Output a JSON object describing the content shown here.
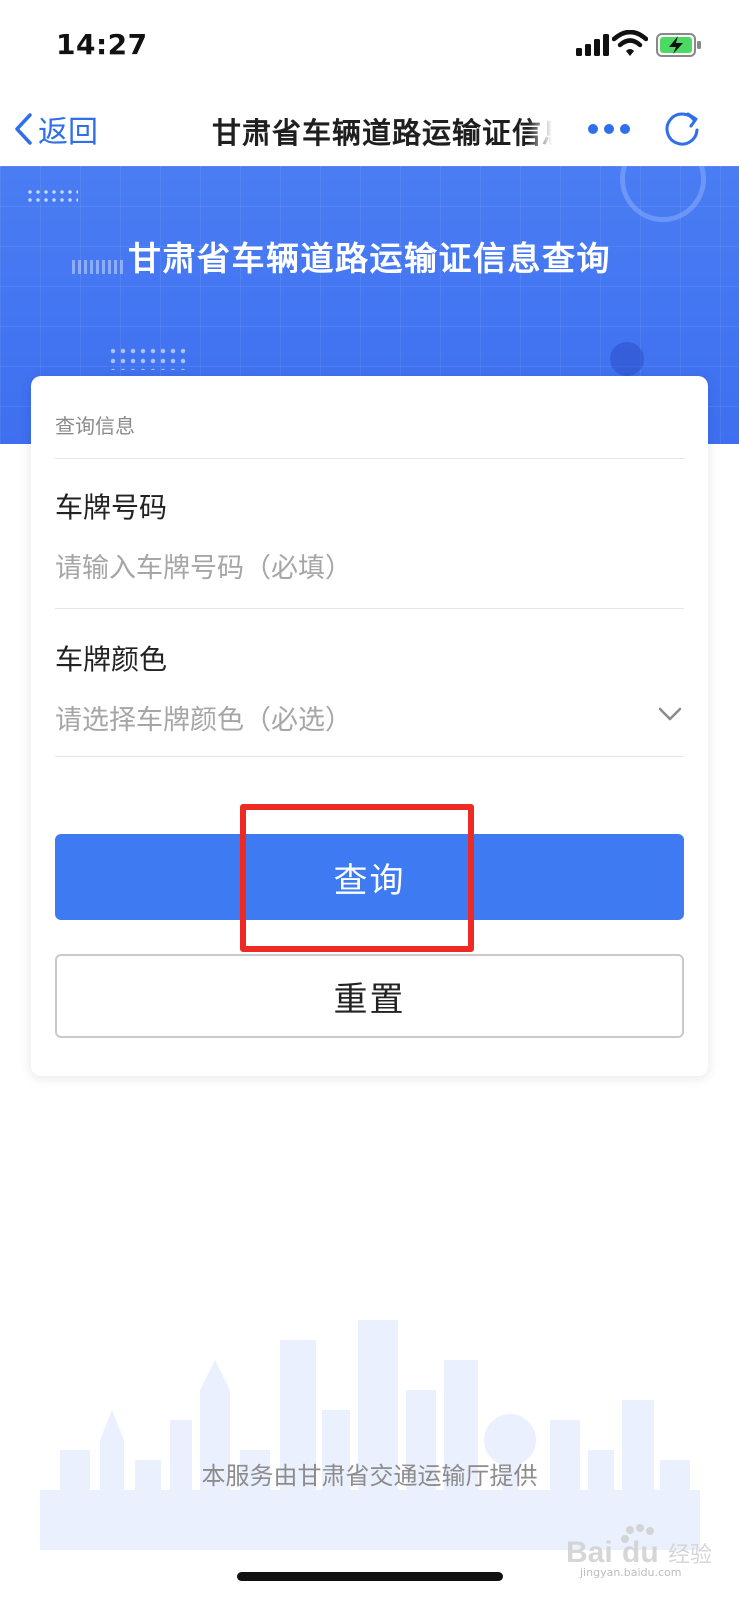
{
  "status_bar": {
    "time": "14:27",
    "icons": [
      "cellular-signal-icon",
      "wifi-icon",
      "battery-charging-icon"
    ]
  },
  "nav": {
    "back_label": "返回",
    "title": "甘肃省车辆道路运输证信息查询",
    "more_icon": "more-icon",
    "refresh_icon": "refresh-icon"
  },
  "banner": {
    "title": "甘肃省车辆道路运输证信息查询",
    "color": "#4277f2"
  },
  "form": {
    "section_label": "查询信息",
    "plate_number": {
      "label": "车牌号码",
      "placeholder": "请输入车牌号码（必填）",
      "value": ""
    },
    "plate_color": {
      "label": "车牌颜色",
      "placeholder": "请选择车牌颜色（必选）",
      "value": ""
    },
    "query_button": "查询",
    "reset_button": "重置"
  },
  "footer": {
    "text": "本服务由甘肃省交通运输厅提供"
  },
  "watermark": {
    "text": "Baidu经验",
    "url": "jingyan.baidu.com"
  },
  "colors": {
    "primary": "#3e7af1",
    "link": "#2f6fea",
    "highlight": "#ee2a24"
  }
}
